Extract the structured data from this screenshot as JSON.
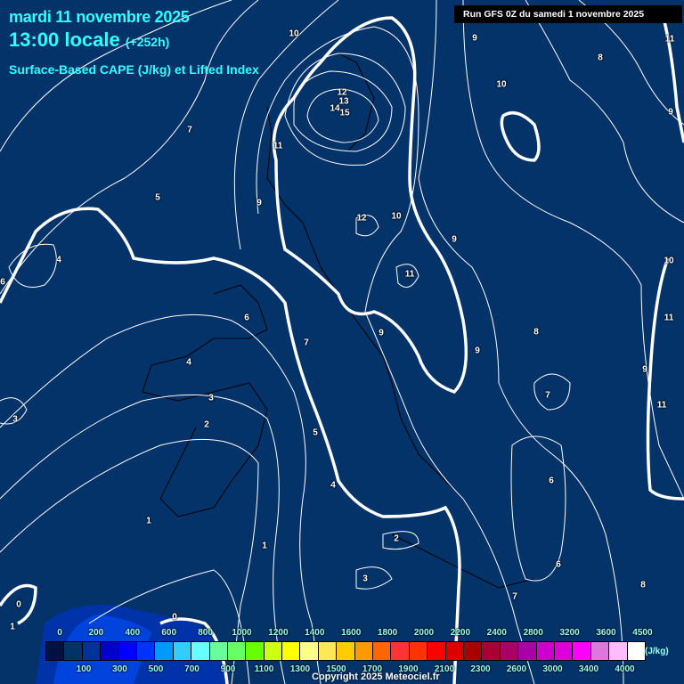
{
  "header": {
    "date": "mardi 11 novembre 2025",
    "time": "13:00 locale",
    "lead": "(+252h)",
    "parameter": "Surface-Based CAPE (J/kg) et Lifted Index",
    "run": "Run GFS 0Z du samedi 1 novembre 2025"
  },
  "contour_labels": [
    "10",
    "9",
    "11",
    "8",
    "12",
    "13",
    "14",
    "15",
    "7",
    "10",
    "9",
    "11",
    "5",
    "9",
    "12",
    "10",
    "9",
    "4",
    "6",
    "11",
    "10",
    "6",
    "11",
    "4",
    "7",
    "9",
    "8",
    "9",
    "9",
    "3",
    "7",
    "11",
    "3",
    "2",
    "5",
    "6",
    "4",
    "1",
    "2",
    "6",
    "3",
    "7",
    "8",
    "0",
    "1",
    "0",
    "1"
  ],
  "legend": {
    "unit": "(J/kg)",
    "top_labels": [
      "0",
      "200",
      "400",
      "600",
      "800",
      "1000",
      "1200",
      "1400",
      "1600",
      "1800",
      "2000",
      "2200",
      "2400",
      "2800",
      "3200",
      "3600",
      "4500"
    ],
    "bottom_labels": [
      "100",
      "300",
      "500",
      "700",
      "900",
      "1100",
      "1300",
      "1500",
      "1700",
      "1900",
      "2100",
      "2300",
      "2600",
      "3000",
      "3400",
      "4000"
    ],
    "colors": [
      "#001040",
      "#003366",
      "#003399",
      "#0000cc",
      "#0000ff",
      "#0033ff",
      "#0099ff",
      "#33ccff",
      "#66ffff",
      "#66ff99",
      "#66ff66",
      "#66ff00",
      "#ccff11",
      "#ffff00",
      "#ffff88",
      "#ffe855",
      "#ffcc00",
      "#ff9900",
      "#ff6600",
      "#ff3333",
      "#ff3300",
      "#ff0000",
      "#dd0000",
      "#aa0000",
      "#aa0033",
      "#aa0066",
      "#aa00aa",
      "#cc00cc",
      "#dd00dd",
      "#ff00ff",
      "#dd77dd",
      "#ffbbff",
      "#ffffff"
    ]
  },
  "copyright": "Copyright 2025 Meteociel.fr"
}
